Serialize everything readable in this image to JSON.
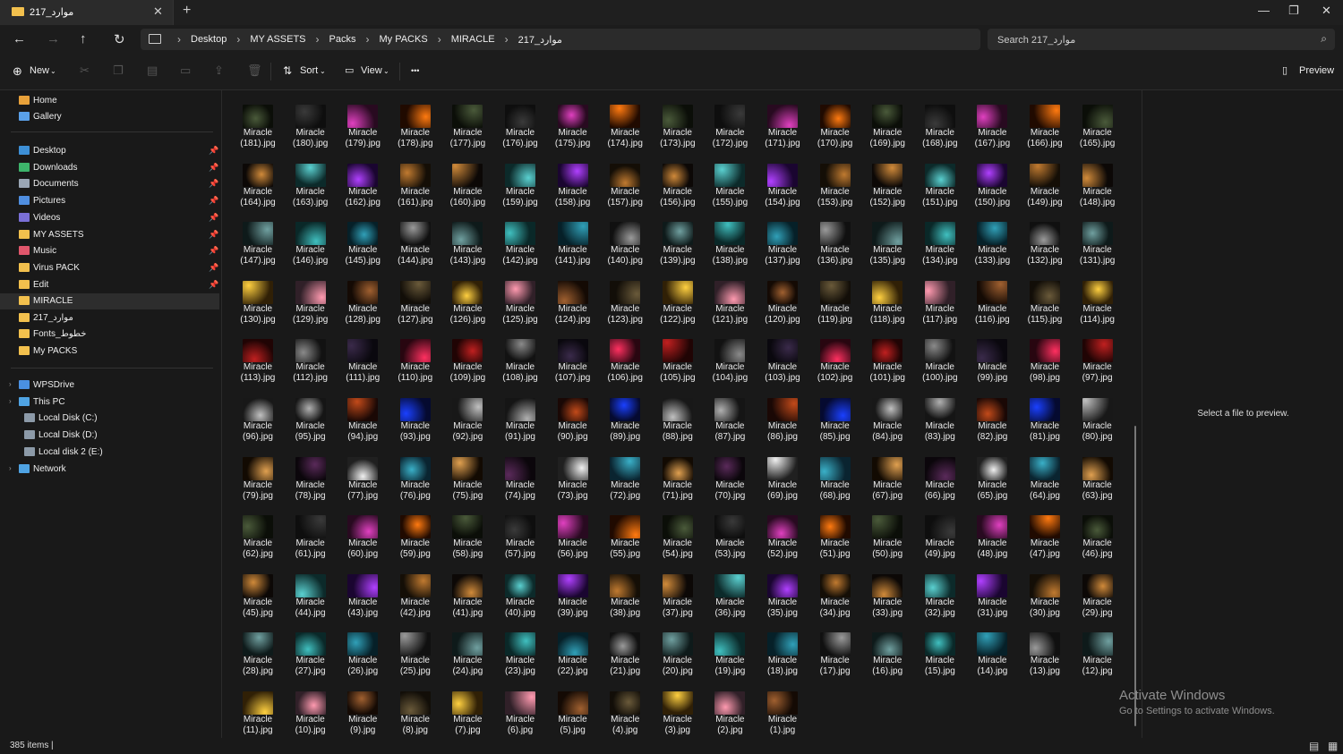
{
  "tab": {
    "title": "موارد_217",
    "close": "✕",
    "new": "+"
  },
  "window": {
    "minimize": "—",
    "maximize": "❐",
    "close": "✕"
  },
  "nav": {
    "back": "←",
    "forward": "→",
    "up": "↑",
    "refresh": "↻"
  },
  "breadcrumb": [
    "Desktop",
    "MY ASSETS",
    "Packs",
    "My PACKS",
    "MIRACLE",
    "موارد_217"
  ],
  "search": {
    "placeholder": "Search موارد_217",
    "icon": "⌕"
  },
  "toolbar": {
    "new": "New",
    "sort": "Sort",
    "view": "View",
    "more": "•••",
    "preview": "Preview"
  },
  "sidebar": {
    "home": "Home",
    "gallery": "Gallery",
    "pinned": [
      "Desktop",
      "Downloads",
      "Documents",
      "Pictures",
      "Videos",
      "MY ASSETS",
      "Music",
      "Virus PACK",
      "Edit"
    ],
    "folders": [
      "MIRACLE",
      "موارد_217",
      "Fonts_خطوط",
      "My PACKS"
    ],
    "drives": [
      "WPSDrive",
      "This PC",
      "Local Disk (C:)",
      "Local Disk (D:)",
      "Local disk 2 (E:)",
      "Network"
    ]
  },
  "files": {
    "prefix": "Miracle",
    "first": 181,
    "last": 1,
    "ext": ".jpg"
  },
  "preview": {
    "message": "Select a file to preview."
  },
  "watermark": {
    "line1": "Activate Windows",
    "line2": "Go to Settings to activate Windows."
  },
  "status": {
    "count": "385 items"
  }
}
